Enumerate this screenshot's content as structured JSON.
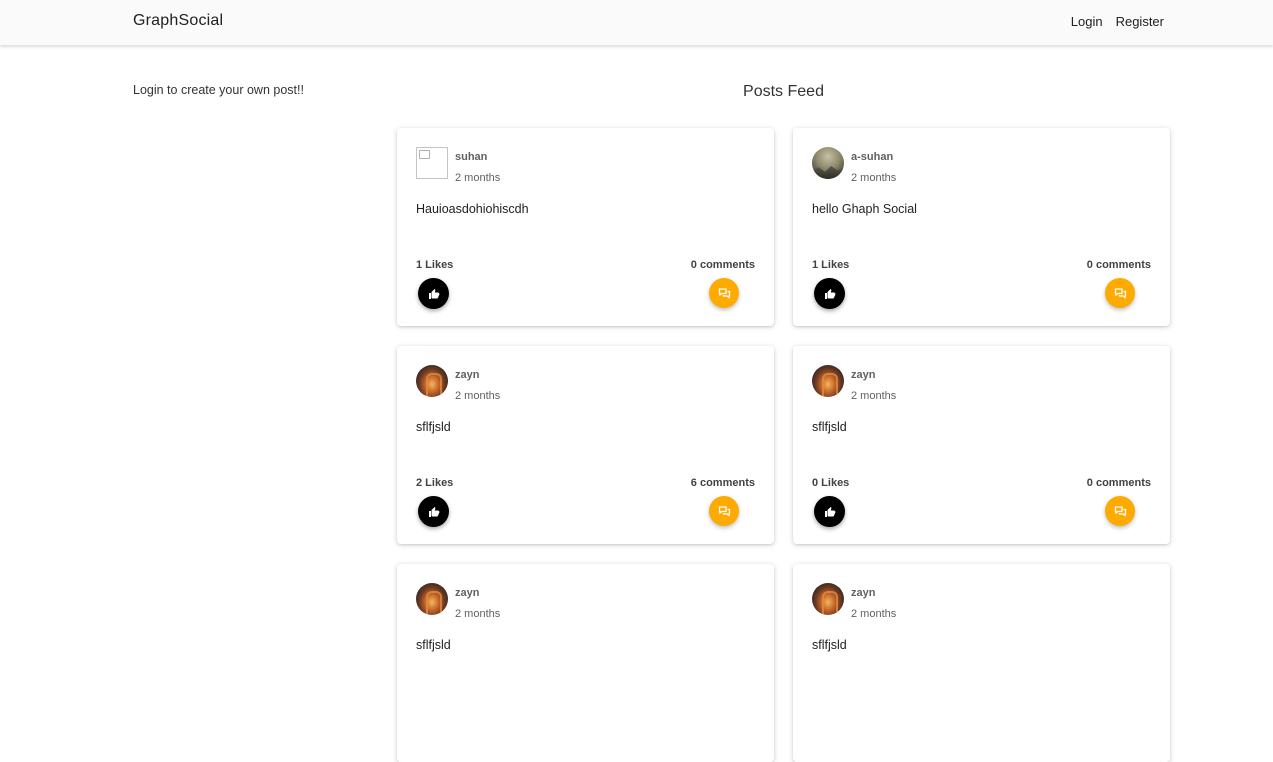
{
  "navbar": {
    "brand": "GraphSocial",
    "links": [
      "Login",
      "Register"
    ]
  },
  "sidebar": {
    "message": "Login to create your own post!!"
  },
  "feed": {
    "title": "Posts Feed",
    "posts": [
      {
        "username": "suhan",
        "time": "2 months",
        "body": "Hauioasdohiohiscdh",
        "likes": "1 Likes",
        "comments": "0 comments",
        "avatar": "broken-image-icon"
      },
      {
        "username": "a-suhan",
        "time": "2 months",
        "body": "hello Ghaph Social",
        "likes": "1 Likes",
        "comments": "0 comments",
        "avatar": "mountain-photo"
      },
      {
        "username": "zayn",
        "time": "2 months",
        "body": "sflfjsld",
        "likes": "2 Likes",
        "comments": "6 comments",
        "avatar": "arch-photo"
      },
      {
        "username": "zayn",
        "time": "2 months",
        "body": "sflfjsld",
        "likes": "0 Likes",
        "comments": "0 comments",
        "avatar": "arch-photo"
      },
      {
        "username": "zayn",
        "time": "2 months",
        "body": "sflfjsld",
        "likes": "",
        "comments": "",
        "avatar": "arch-photo"
      },
      {
        "username": "zayn",
        "time": "2 months",
        "body": "sflfjsld",
        "likes": "",
        "comments": "",
        "avatar": "arch-photo"
      }
    ]
  },
  "colors": {
    "like_button": "#000000",
    "comment_button": "#fdab00",
    "navbar_bg": "#fafafa"
  },
  "icons": {
    "like": "thumbs-up-icon",
    "comment": "comments-icon"
  }
}
